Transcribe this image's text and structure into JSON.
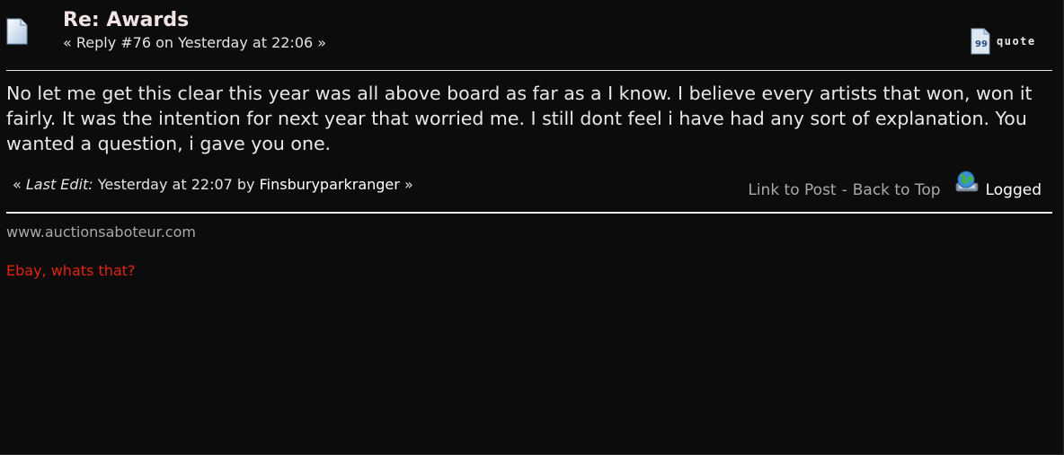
{
  "post": {
    "icon": "document-icon",
    "subject": "Re: Awards",
    "reply_info": "« Reply #76 on Yesterday at 22:06 »",
    "quote_label": "quote",
    "body": "No let me get this clear this year was all above board as far as a I know. I believe every artists that won, won it fairly. It was the intention for next year that worried me. I still dont feel i have had any sort of explanation. You wanted a question, i gave you one.",
    "last_edit": {
      "open": "«",
      "label": "Last Edit:",
      "when": "Yesterday at 22:07 by",
      "editor": "Finsburyparkranger",
      "close": "»"
    },
    "links": {
      "link_to_post": "Link to Post",
      "separator": "-",
      "back_to_top": "Back to Top",
      "logged": "Logged",
      "logged_icon": "globe-computer-icon"
    }
  },
  "signature": {
    "site": "www.auctionsaboteur.com",
    "tagline": "Ebay, whats that?",
    "tagline_color": "#e2230f"
  }
}
